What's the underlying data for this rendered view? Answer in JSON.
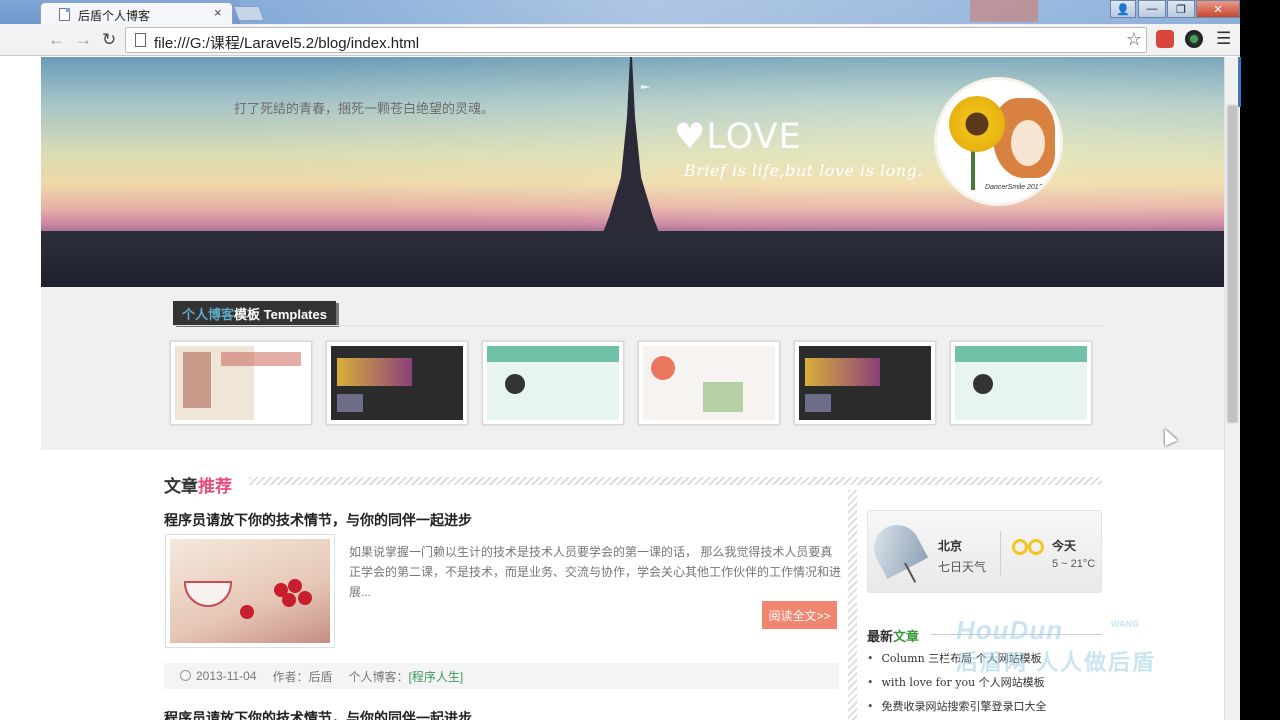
{
  "browser": {
    "tab_title": "后盾个人博客",
    "tab_close": "×",
    "url": "file:///G:/课程/Laravel5.2/blog/index.html",
    "window_controls": [
      "—",
      "❐",
      "✕"
    ]
  },
  "banner": {
    "motto": "打了死结的青春，捆死一颗苍白绝望的灵魂。",
    "love_title": "LOVE",
    "love_subtitle": "Brief is life,but love is long.",
    "avatar_signature": "DancerSmile 2012"
  },
  "templates": {
    "heading_highlight": "个人博客",
    "heading_rest": "模板 Templates",
    "items": [
      "template-1",
      "template-2",
      "template-3",
      "template-4",
      "template-5",
      "template-6"
    ]
  },
  "articles": {
    "section_title_plain": "文章",
    "section_title_highlight": "推荐",
    "first": {
      "title": "程序员请放下你的技术情节，与你的同伴一起进步",
      "excerpt": "如果说掌握一门赖以生计的技术是技术人员要学会的第一课的话， 那么我觉得技术人员要真正学会的第二课，不是技术，而是业务、交流与协作，学会关心其他工作伙伴的工作情况和进展...",
      "read_more": "阅读全文>>",
      "date": "2013-11-04",
      "author": "作者：后盾",
      "category_label": "个人博客：",
      "category": "[程序人生]"
    },
    "second_title": "程序员请放下你的技术情节，与你的同伴一起进步"
  },
  "sidebar": {
    "weather": {
      "city": "北京",
      "week": "七日天气",
      "today": "今天",
      "temp": "5 ~ 21°C"
    },
    "latest_plain": "最新",
    "latest_highlight": "文章",
    "latest_items": [
      "Column 三栏布局 个人网站模板",
      "with love for you 个人网站模板",
      "免费收录网站搜索引擎登录口大全"
    ]
  },
  "watermark": {
    "line1": "HouDun",
    "line1_small": "WANG",
    "line2": "后盾网 人人做后盾"
  },
  "colors": {
    "accent_pink": "#e84c7d",
    "accent_green": "#3a9a3a",
    "read_more_bg": "#f0866f",
    "template_heading_blue": "#5fa8c9"
  }
}
